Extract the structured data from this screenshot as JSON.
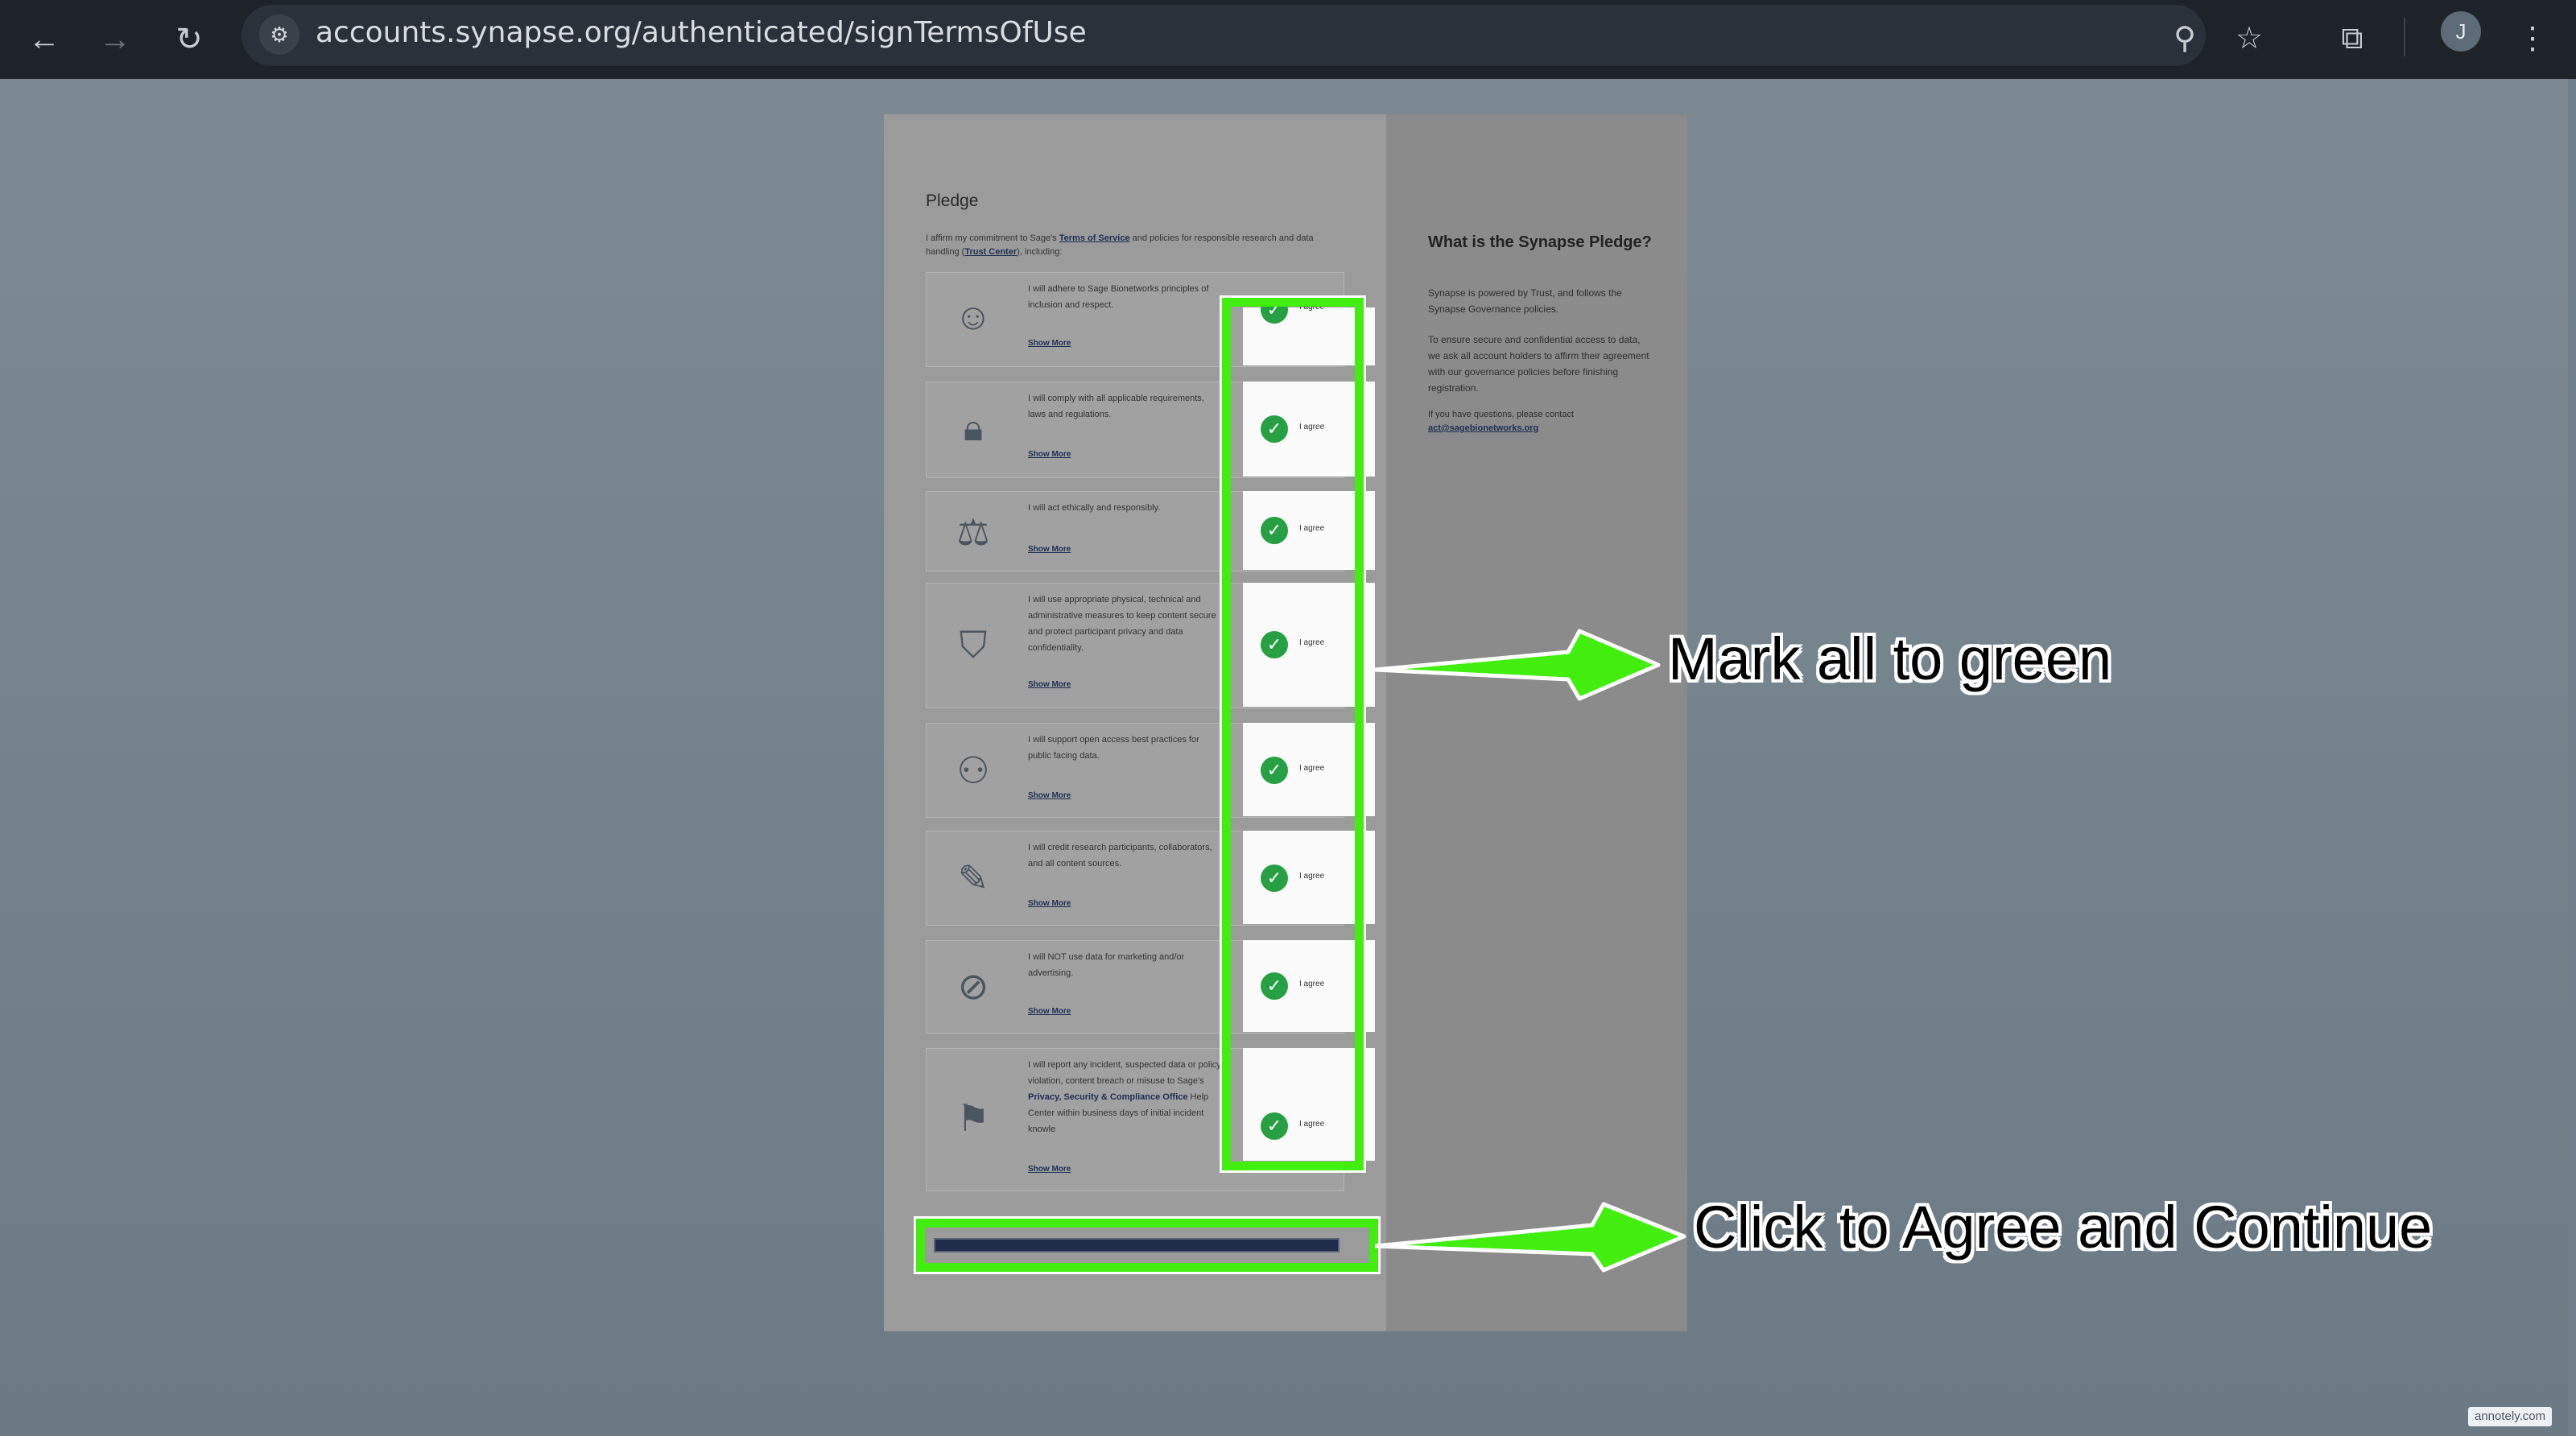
{
  "browser": {
    "url": "accounts.synapse.org/authenticated/signTermsOfUse",
    "avatar_letter": "J",
    "icons": {
      "back": "arrow-left-icon",
      "forward": "arrow-right-icon",
      "reload": "reload-icon",
      "site_info": "tune-icon",
      "zoom": "magnifier-icon",
      "bookmark": "star-icon",
      "extensions": "puzzle-icon",
      "menu": "kebab-menu-icon"
    }
  },
  "pledge": {
    "title": "Pledge",
    "intro_prefix": "I affirm my commitment to Sage's ",
    "intro_link1": "Terms of Service",
    "intro_mid": " and policies for responsible research and data handling (",
    "intro_link2": "Trust Center",
    "intro_suffix": "), including:",
    "show_more": "Show More",
    "agree_label": "I agree",
    "items": [
      {
        "text": "I will adhere to Sage Bionetworks principles of inclusion and respect.",
        "icon": "chat-faces-icon",
        "agreed": true
      },
      {
        "text": "I will comply with all applicable requirements, laws and regulations.",
        "icon": "padlock-icon",
        "agreed": true
      },
      {
        "text": "I will act ethically and responsibly.",
        "icon": "scales-icon",
        "agreed": true
      },
      {
        "text": "I will use appropriate physical, technical and administrative measures to keep content secure and protect participant privacy and data confidentiality.",
        "icon": "shield-check-icon",
        "agreed": true
      },
      {
        "text": "I will support open access best practices for public facing data.",
        "icon": "people-circle-icon",
        "agreed": true
      },
      {
        "text": "I will credit research participants, collaborators, and all content sources.",
        "icon": "pencil-icon",
        "agreed": true
      },
      {
        "text": "I will NOT use data for marketing and/or advertising.",
        "icon": "no-advertising-icon",
        "agreed": true
      },
      {
        "text_before": "I will report any incident, suspected data or policy violation, content breach or misuse to Sage's ",
        "text_link": "Privacy, Security & Compliance Office",
        "text_after": " Help Center within business days of initial incident knowle",
        "icon": "flag-icon",
        "agreed": true
      }
    ]
  },
  "sidebar": {
    "title": "What is the Synapse Pledge?",
    "p1": "Synapse is powered by Trust, and follows the Synapse Governance policies.",
    "p2": "To ensure secure and confidential access to data, we ask all account holders to affirm their agreement with our governance policies before finishing registration.",
    "p3": "If you have questions, please contact",
    "email": "act@sagebionetworks.org"
  },
  "annotations": {
    "caption1": "Mark all to green",
    "caption2": "Click to Agree and Continue",
    "color": "#41ee0e"
  },
  "watermark": "annotely.com"
}
